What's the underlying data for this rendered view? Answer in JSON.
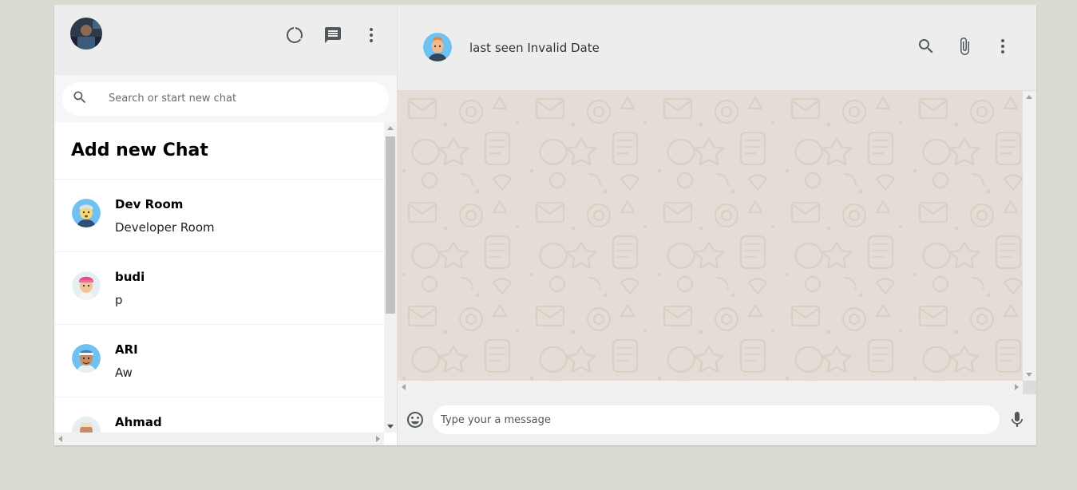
{
  "sidebar": {
    "search_placeholder": "Search or start new chat",
    "add_new_chat": "Add new Chat",
    "chats": [
      {
        "name": "Dev Room",
        "message": "Developer Room"
      },
      {
        "name": "budi",
        "message": "p"
      },
      {
        "name": "ARI",
        "message": "Aw"
      },
      {
        "name": "Ahmad",
        "message": ""
      }
    ]
  },
  "chat": {
    "last_seen": "last seen Invalid Date",
    "input_placeholder": "Type your a message"
  },
  "icons": {
    "status": "status-icon",
    "new_chat": "chat-icon",
    "menu": "more-vert-icon",
    "search": "search-icon",
    "attach": "attach-file-icon",
    "emoji": "emoji-icon",
    "mic": "mic-icon"
  },
  "colors": {
    "background": "#dadbd3",
    "header": "#ededed",
    "chat_wallpaper": "#e5ddd5",
    "icon_grey": "#51585c"
  }
}
